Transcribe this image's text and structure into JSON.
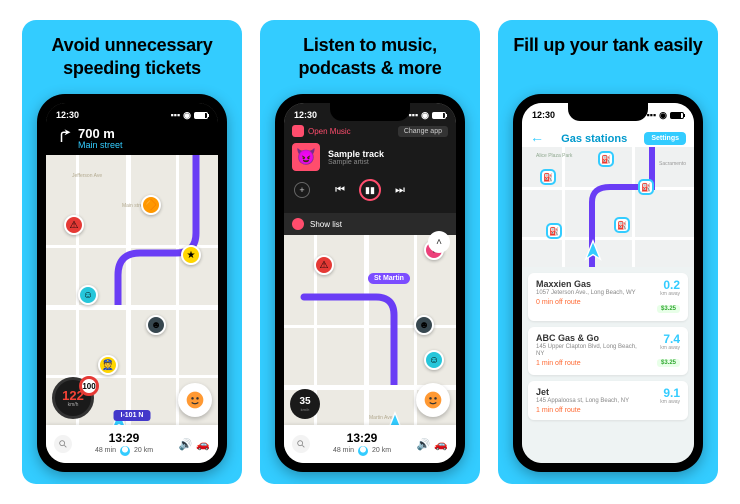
{
  "panels": [
    {
      "title": "Avoid unnecessary speeding tickets"
    },
    {
      "title": "Listen to music, podcasts & more"
    },
    {
      "title": "Fill up your tank easily"
    }
  ],
  "status": {
    "time": "12:30"
  },
  "nav": {
    "distance": "700 m",
    "street": "Main street",
    "route_label": "I-101 N",
    "street_jefferson": "Jefferson Ave",
    "street_main": "Main street",
    "street_martin": "Martin Ave",
    "place_stmartin": "St Martin"
  },
  "speed": {
    "current": "122",
    "unit": "km/h",
    "limit": "100",
    "small": "35"
  },
  "eta": {
    "time": "13:29",
    "duration": "48 min",
    "distance": "20 km"
  },
  "music": {
    "source": "Open Music",
    "change_label": "Change app",
    "track": "Sample track",
    "artist": "Sample artist",
    "showlist": "Show list"
  },
  "gas": {
    "title": "Gas stations",
    "settings": "Settings",
    "area_label": "Alice Plaza Park",
    "area_label2": "Sacramento",
    "stations": [
      {
        "name": "Maxxien Gas",
        "addr": "1057 Jeterson Ave., Long Beach, WY",
        "off": "0 min off route",
        "dist": "0.2",
        "distu": "km away",
        "price": "$3.25"
      },
      {
        "name": "ABC Gas & Go",
        "addr": "145 Upper Clapton Blvd, Long Beach, NY",
        "off": "1 min off route",
        "dist": "7.4",
        "distu": "km away",
        "price": "$3.25"
      },
      {
        "name": "Jet",
        "addr": "145 Appaloosa st, Long Beach, NY",
        "off": "1 min off route",
        "dist": "9.1",
        "distu": "km away",
        "price": ""
      }
    ]
  }
}
